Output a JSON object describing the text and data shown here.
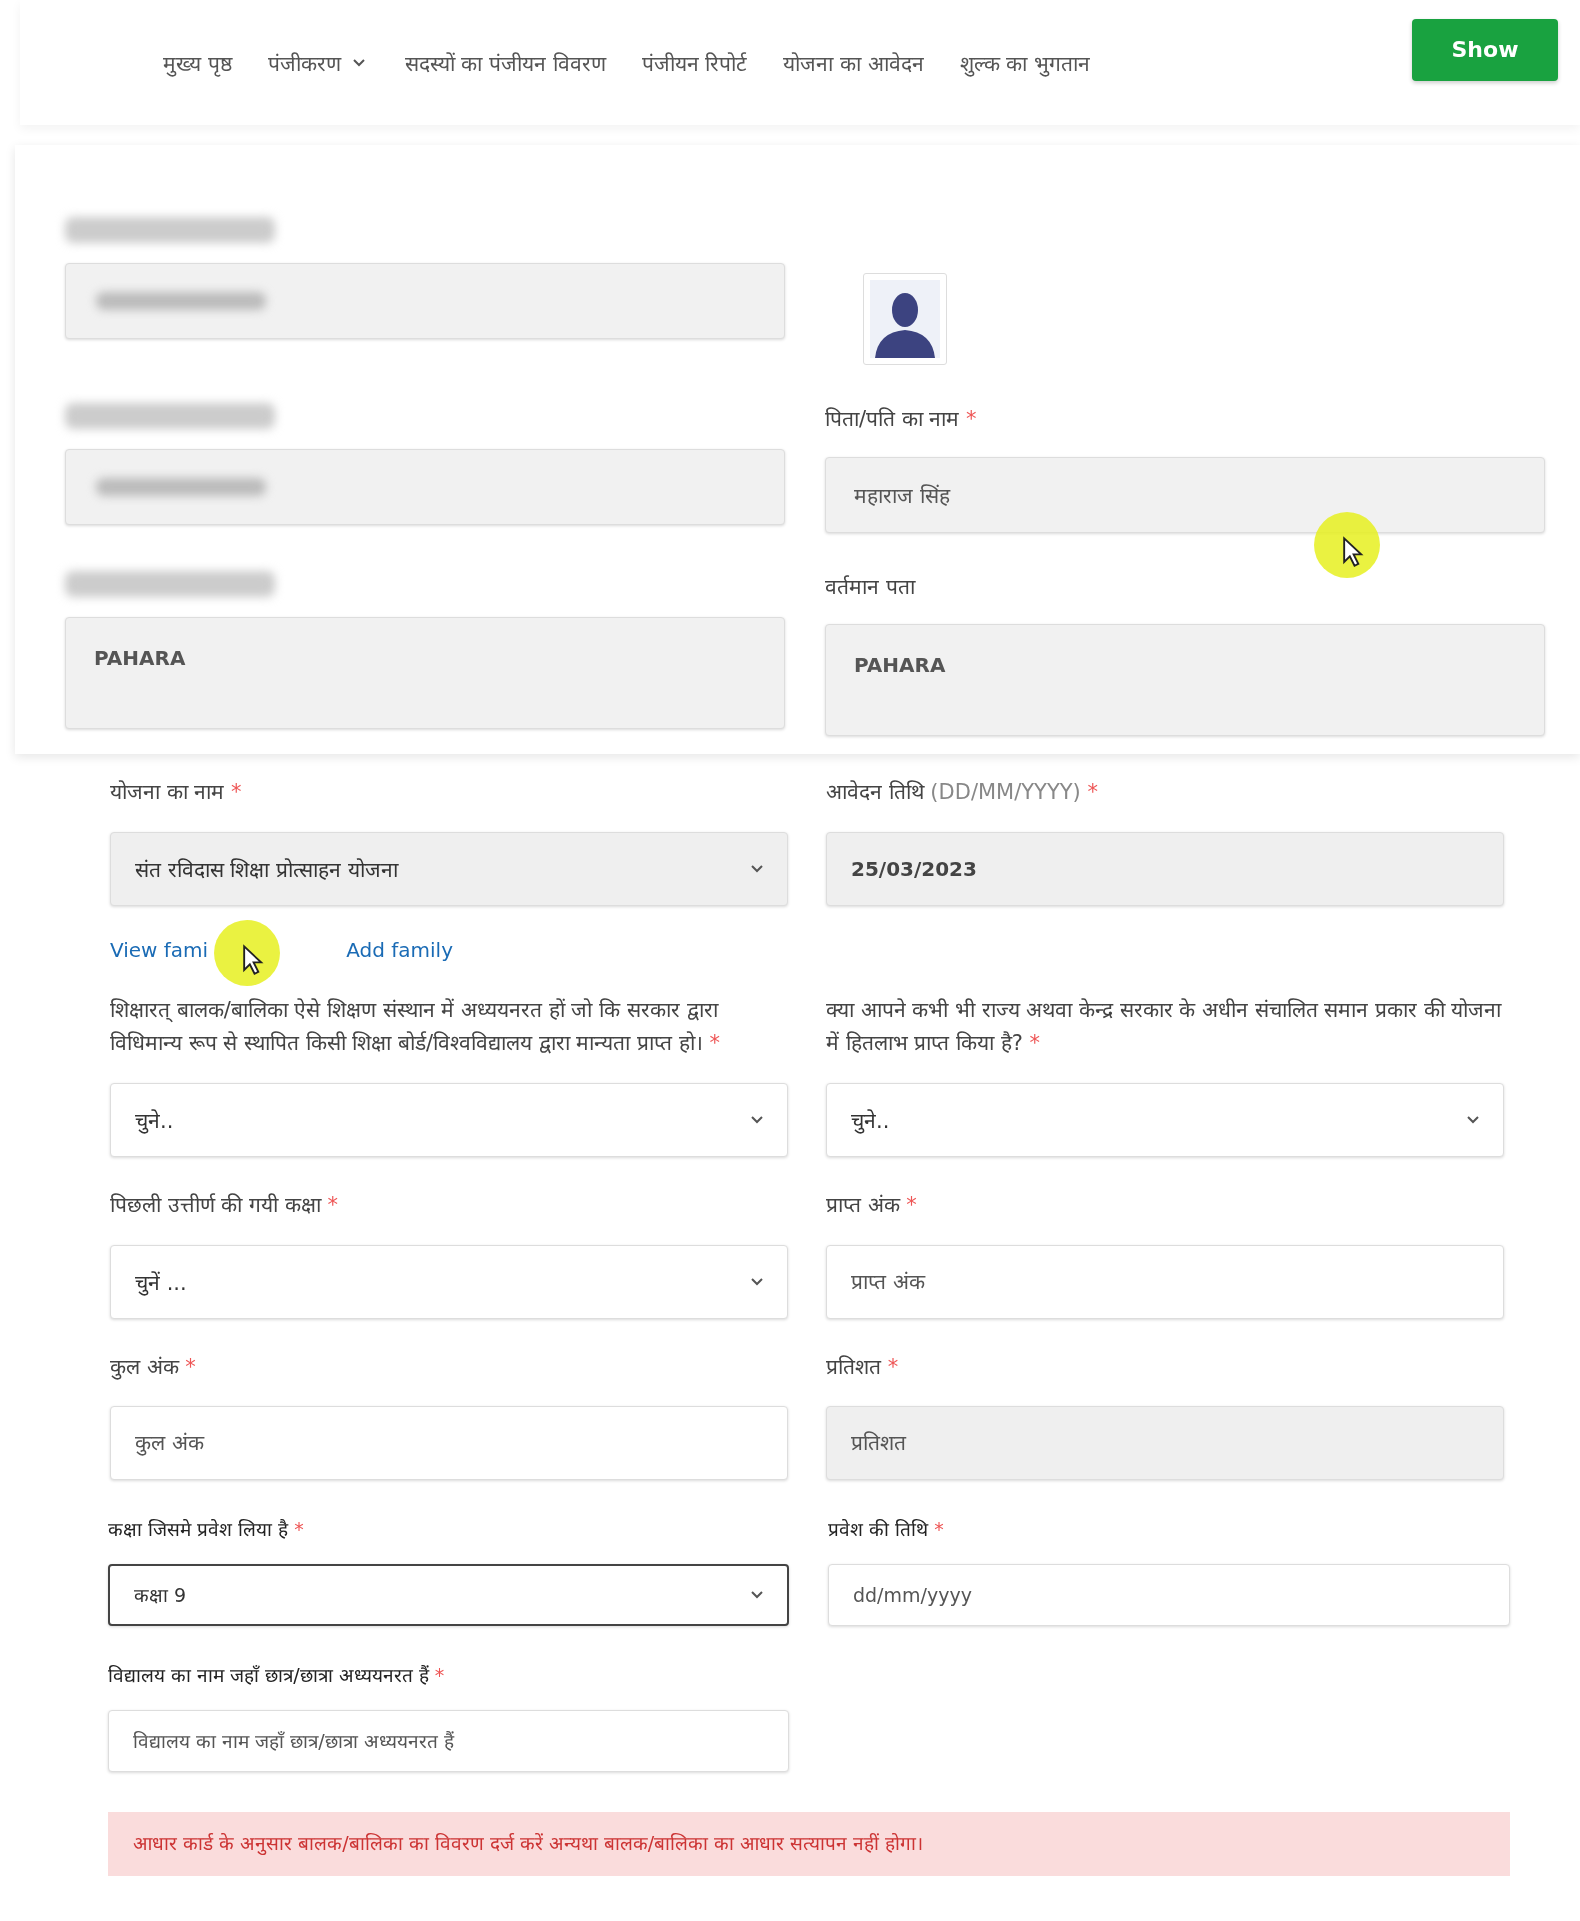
{
  "nav": {
    "items": [
      {
        "label": "मुख्य पृष्ठ",
        "dropdown": false
      },
      {
        "label": "पंजीकरण",
        "dropdown": true
      },
      {
        "label": "सदस्यों का पंजीयन विवरण",
        "dropdown": false
      },
      {
        "label": "पंजीयन रिपोर्ट",
        "dropdown": false
      },
      {
        "label": "योजना का आवेदन",
        "dropdown": false
      },
      {
        "label": "शुल्क का भुगतान",
        "dropdown": false
      }
    ],
    "button": "Show"
  },
  "profile": {
    "rows": [
      [
        {
          "kind": "field",
          "label_blurred": true,
          "value_blurred": true
        },
        {
          "kind": "photo"
        }
      ],
      [
        {
          "kind": "field",
          "label_blurred": true,
          "value_blurred": true
        },
        {
          "kind": "field",
          "label": "पिता/पति का नाम",
          "mark": "*",
          "value": "महाराज सिंह"
        }
      ],
      [
        {
          "kind": "area",
          "label_blurred": true,
          "value": "PAHARA"
        },
        {
          "kind": "area",
          "label": "वर्तमान पता",
          "value": "PAHARA"
        }
      ]
    ]
  },
  "scheme": {
    "rows": [
      [
        {
          "kind": "select",
          "label": "योजना का नाम",
          "mark": "*",
          "value": "संत रविदास शिक्षा प्रोत्साहन योजना",
          "disabled": true
        },
        {
          "kind": "input",
          "label": "आवेदन तिथि",
          "hint": "(DD/MM/YYYY)",
          "mark": "*",
          "value": "25/03/2023",
          "disabled": true
        }
      ],
      [
        {
          "kind": "links",
          "links": [
            "View fami",
            "Add family"
          ]
        }
      ],
      [
        {
          "kind": "select",
          "label": "शिक्षारत् बालक/बालिका ऐसे शिक्षण संस्थान में अध्ययनरत हों जो कि सरकार द्वारा विधिमान्य रूप से स्थापित किसी शिक्षा बोर्ड/विश्वविद्यालय द्वारा मान्यता प्राप्त हो।",
          "mark": "*",
          "value": "चुने..",
          "disabled": false
        },
        {
          "kind": "select",
          "label": "क्या आपने कभी भी राज्य अथवा केन्द्र सरकार के अधीन संचालित समान प्रकार की योजना में हितलाभ प्राप्त किया है?",
          "mark": "*",
          "value": "चुने..",
          "disabled": false
        }
      ],
      [
        {
          "kind": "select",
          "label": "पिछली उत्तीर्ण की गयी कक्षा",
          "mark": "*",
          "value": "चुनें ...",
          "disabled": false
        },
        {
          "kind": "input",
          "label": "प्राप्त अंक",
          "mark": "*",
          "placeholder": "प्राप्त अंक",
          "disabled": false
        }
      ],
      [
        {
          "kind": "input",
          "label": "कुल अंक",
          "mark": "*",
          "placeholder": "कुल अंक",
          "disabled": false
        },
        {
          "kind": "input",
          "label": "प्रतिशत",
          "mark": "*",
          "placeholder": "प्रतिशत",
          "disabled": true
        }
      ]
    ]
  },
  "admission": {
    "rows": [
      [
        {
          "kind": "select",
          "label": "कक्षा जिसमे प्रवेश लिया है",
          "mark": "*",
          "value": "कक्षा 9",
          "focused": true
        },
        {
          "kind": "input",
          "label": "प्रवेश की तिथि",
          "mark": "*",
          "placeholder": "dd/mm/yyyy",
          "focused": false
        }
      ],
      [
        {
          "kind": "input",
          "label": "विद्यालय का नाम जहाँ छात्र/छात्रा अध्ययनरत हैं",
          "mark": "*",
          "placeholder": "विद्यालय का नाम जहाँ छात्र/छात्रा अध्ययनरत हैं",
          "focused": false
        }
      ]
    ],
    "alert": "आधार कार्ड के अनुसार बालक/बालिका का विवरण दर्ज करें अन्यथा बालक/बालिका का आधार सत्यापन नहीं होगा।"
  }
}
